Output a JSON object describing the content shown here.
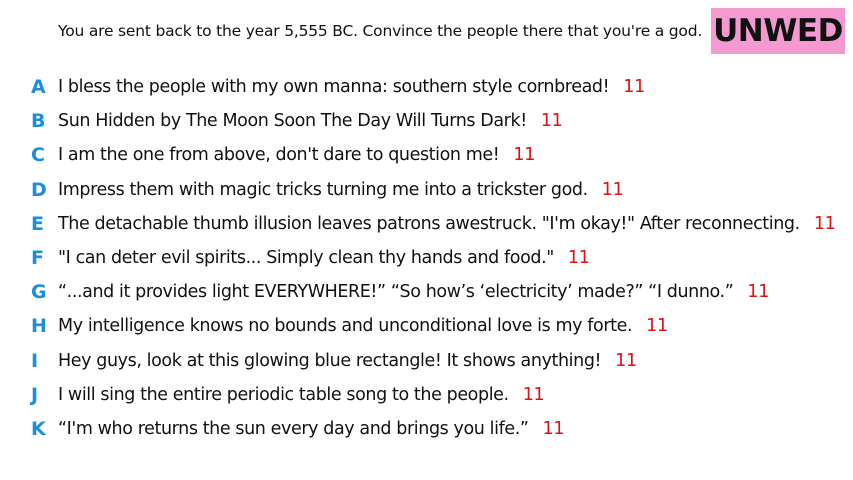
{
  "prompt": "You are sent back to the year 5,555 BC. Convince the people there that you're a god.",
  "badge": {
    "label": "UNWED",
    "color": "#f49ad0"
  },
  "colors": {
    "letter": "#1a8fe0",
    "score": "#e01010",
    "text": "#111111"
  },
  "answers": [
    {
      "letter": "A",
      "text": "I bless the people with my own manna: southern style cornbread!",
      "score": "11"
    },
    {
      "letter": "B",
      "text": "Sun Hidden by The Moon Soon The Day Will Turns Dark!",
      "score": "11"
    },
    {
      "letter": "C",
      "text": "I am the one from above, don't dare to question me!",
      "score": "11"
    },
    {
      "letter": "D",
      "text": "Impress them with magic tricks turning me into a trickster god.",
      "score": "11"
    },
    {
      "letter": "E",
      "text": "The detachable thumb illusion leaves patrons awestruck. \"I'm okay!\" After reconnecting.",
      "score": "11"
    },
    {
      "letter": "F",
      "text": "\"I can deter evil spirits... Simply clean thy hands and food.\"",
      "score": "11"
    },
    {
      "letter": "G",
      "text": "“...and it provides light EVERYWHERE!” “So how’s ‘electricity’ made?” “I dunno.”",
      "score": "11"
    },
    {
      "letter": "H",
      "text": "My intelligence knows no bounds and unconditional love is my forte.",
      "score": "11"
    },
    {
      "letter": "I",
      "text": "Hey guys, look at this glowing blue rectangle! It shows anything!",
      "score": "11"
    },
    {
      "letter": "J",
      "text": "I will sing the entire periodic table song to the people.",
      "score": "11"
    },
    {
      "letter": "K",
      "text": "“I'm who returns the sun every day and brings you life.”",
      "score": "11"
    }
  ]
}
